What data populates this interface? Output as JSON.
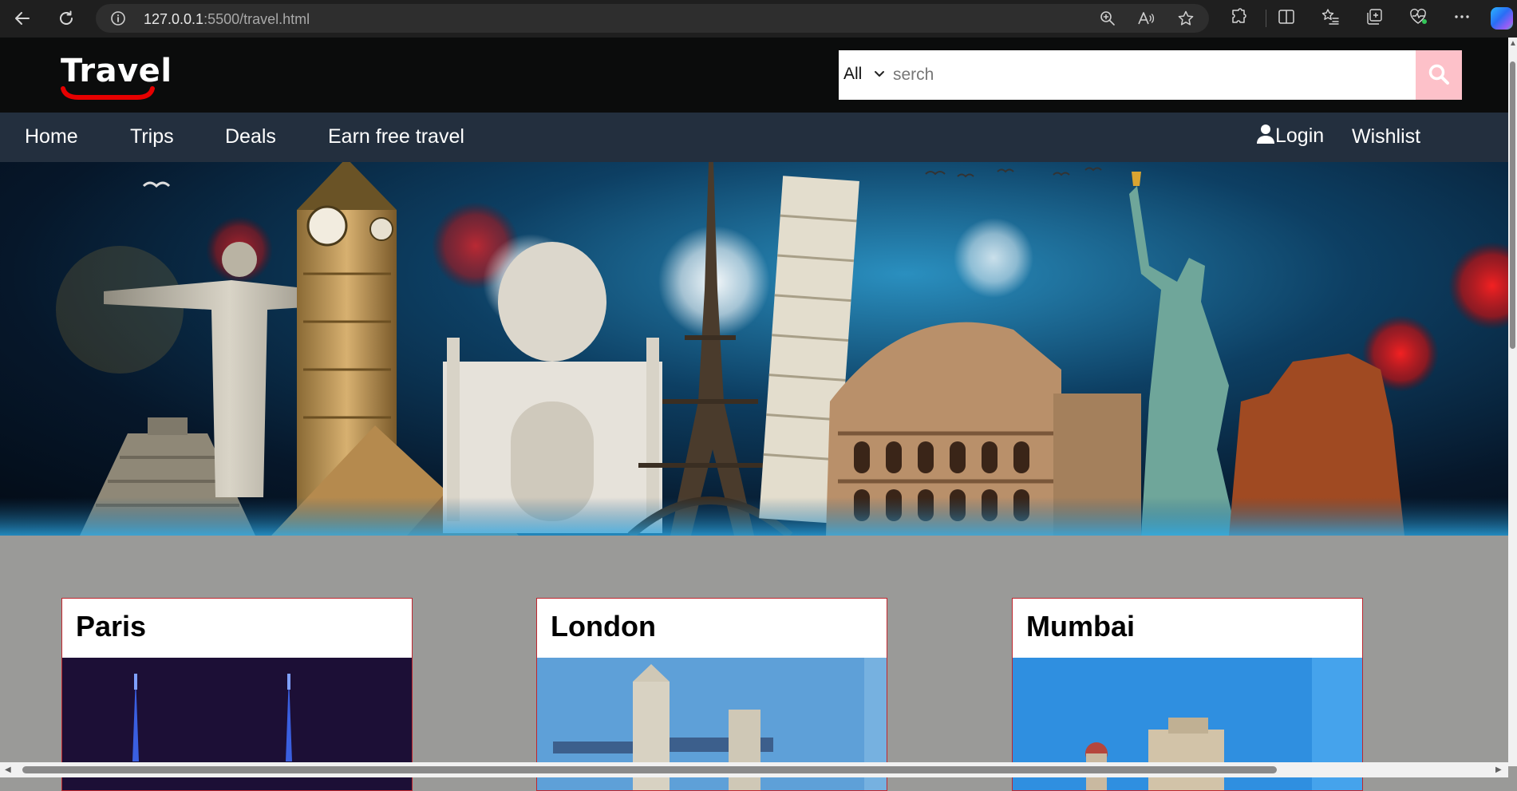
{
  "browser": {
    "url_host": "127.0.0.1",
    "url_rest": ":5500/travel.html",
    "icons": [
      "back-icon",
      "refresh-icon",
      "info-icon",
      "zoom-icon",
      "read-aloud-icon",
      "favorite-star-icon",
      "extensions-icon",
      "split-screen-icon",
      "favorites-icon",
      "collections-icon",
      "browser-essentials-icon",
      "more-icon",
      "copilot-icon"
    ]
  },
  "header": {
    "logo_text": "Travel",
    "logo_underline_color": "#e60000",
    "search": {
      "category": "All",
      "placeholder": "serch",
      "button_color": "#fdc1c9"
    }
  },
  "nav": {
    "links": [
      "Home",
      "Trips",
      "Deals",
      "Earn free travel"
    ],
    "login": "Login",
    "wishlist": "Wishlist",
    "background": "#232f3e"
  },
  "cards": [
    {
      "title": "Paris"
    },
    {
      "title": "London"
    },
    {
      "title": "Mumbai"
    }
  ]
}
